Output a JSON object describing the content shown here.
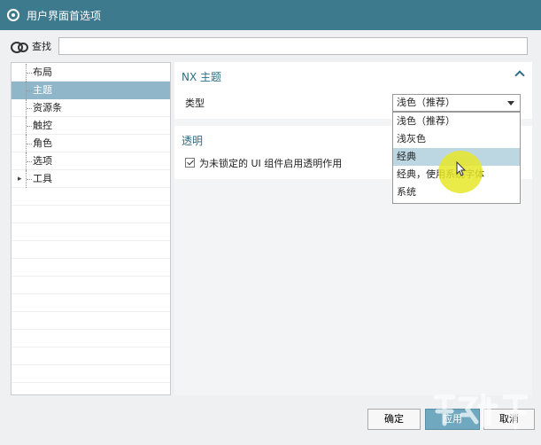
{
  "window": {
    "title": "用户界面首选项"
  },
  "search": {
    "label": "查找",
    "value": ""
  },
  "tree": {
    "items": [
      {
        "label": "布局",
        "selected": false,
        "expandable": false
      },
      {
        "label": "主题",
        "selected": true,
        "expandable": false
      },
      {
        "label": "资源条",
        "selected": false,
        "expandable": false
      },
      {
        "label": "触控",
        "selected": false,
        "expandable": false
      },
      {
        "label": "角色",
        "selected": false,
        "expandable": false
      },
      {
        "label": "选项",
        "selected": false,
        "expandable": false
      },
      {
        "label": "工具",
        "selected": false,
        "expandable": true
      }
    ]
  },
  "theme_section": {
    "title": "NX 主题",
    "type_label": "类型",
    "selected_value": "浅色（推荐）",
    "options": [
      "浅色（推荐）",
      "浅灰色",
      "经典",
      "经典，使用系统字体",
      "系统"
    ],
    "hovered_option": "经典"
  },
  "transparency_section": {
    "title": "透明",
    "checkbox_label": "为未锁定的 UI 组件启用透明作用",
    "checked": true
  },
  "buttons": {
    "ok": "确定",
    "apply": "应用",
    "cancel": "取消"
  },
  "colors": {
    "titlebar": "#3e7a8e",
    "accent": "#2e6e86",
    "selected": "#8fb7c9",
    "highlight": "#e6e628"
  }
}
